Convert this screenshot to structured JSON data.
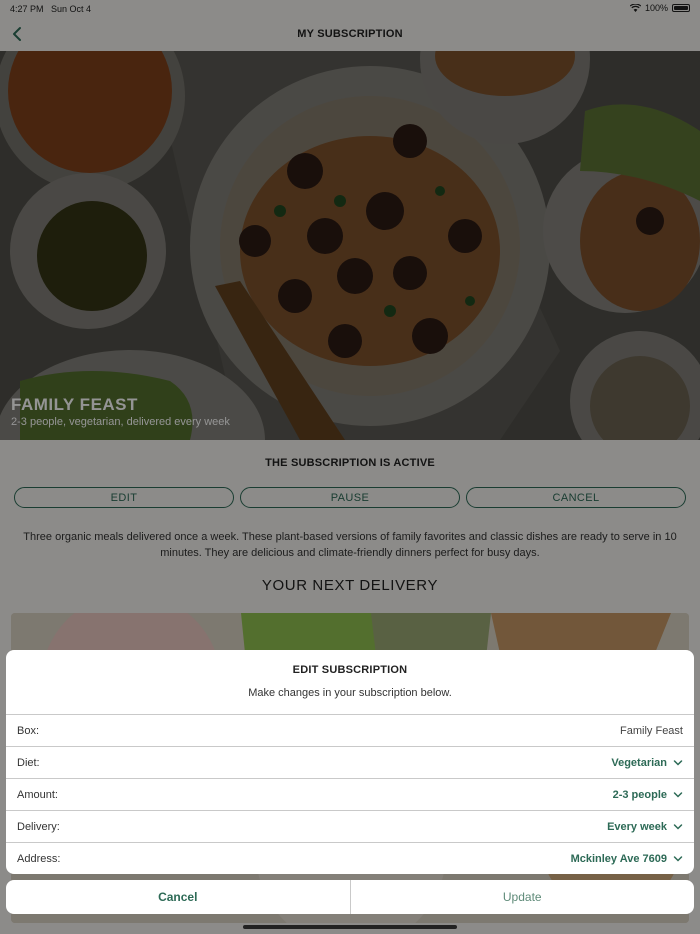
{
  "status_bar": {
    "time": "4:27 PM",
    "date": "Sun Oct 4",
    "battery": "100%"
  },
  "nav": {
    "title": "MY SUBSCRIPTION"
  },
  "hero": {
    "title": "FAMILY FEAST",
    "subtitle": "2-3 people, vegetarian, delivered every week"
  },
  "subscription": {
    "status": "THE SUBSCRIPTION IS ACTIVE",
    "actions": {
      "edit": "EDIT",
      "pause": "PAUSE",
      "cancel": "CANCEL"
    },
    "description": "Three organic meals delivered once a week. These plant-based versions of family favorites and classic dishes are ready to serve in 10 minutes. They are delicious and climate-friendly dinners perfect for busy days.",
    "next_delivery_title": "YOUR NEXT DELIVERY"
  },
  "sheet": {
    "title": "EDIT SUBSCRIPTION",
    "subtitle": "Make changes in your subscription below.",
    "rows": [
      {
        "label": "Box:",
        "value": "Family Feast"
      },
      {
        "label": "Diet:",
        "value": "Vegetarian"
      },
      {
        "label": "Amount:",
        "value": "2-3 people"
      },
      {
        "label": "Delivery:",
        "value": "Every week"
      },
      {
        "label": "Address:",
        "value": "Mckinley Ave 7609"
      }
    ],
    "cancel": "Cancel",
    "update": "Update"
  },
  "colors": {
    "accent": "#2d6a56",
    "background": "#f1f0ec",
    "overlay": "rgba(0,0,0,0.42)"
  }
}
